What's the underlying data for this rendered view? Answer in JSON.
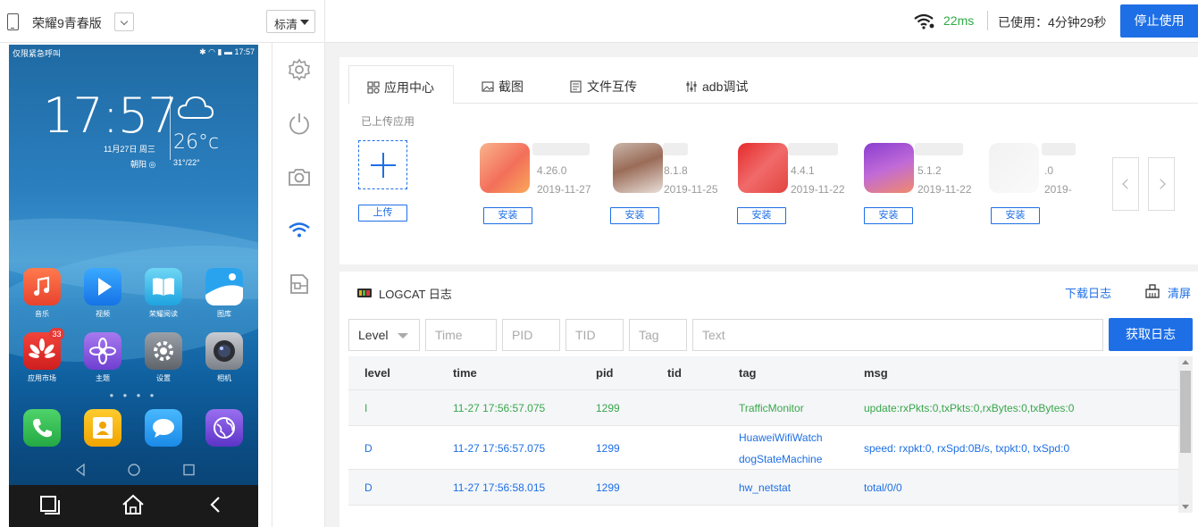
{
  "topbar": {
    "device_name": "荣耀9青春版",
    "quality": "标清",
    "ping": "22ms",
    "used_time": "已使用：4分钟29秒",
    "stop_button": "停止使用"
  },
  "phone": {
    "status_left": "仅限紧急呼叫",
    "status_right": "17:57",
    "clock": "17:57",
    "date": "11月27日  周三",
    "location": "朝阳",
    "temperature": "26°c",
    "temp_range": "31°/22°",
    "apps_row1": [
      {
        "label": "音乐",
        "icon": "music-icon",
        "color": "#f0543a"
      },
      {
        "label": "视频",
        "icon": "video-play-icon",
        "color": "#1c8cf0"
      },
      {
        "label": "荣耀阅读",
        "icon": "book-icon",
        "color": "#2fb7e6"
      },
      {
        "label": "图库",
        "icon": "gallery-icon",
        "color": "#3aa4ee"
      }
    ],
    "apps_row2": [
      {
        "label": "应用市场",
        "icon": "app-market-icon",
        "color": "#e02b2b",
        "badge": "33"
      },
      {
        "label": "主题",
        "icon": "theme-icon",
        "color": "#8b5bd9"
      },
      {
        "label": "设置",
        "icon": "settings-icon",
        "color": "#7b7f86"
      },
      {
        "label": "相机",
        "icon": "camera-icon",
        "color": "#6a6e74"
      }
    ],
    "dock": [
      {
        "icon": "phone-call-icon",
        "color": "#3bc25a"
      },
      {
        "icon": "contacts-icon",
        "color": "#f5b40c"
      },
      {
        "icon": "messages-icon",
        "color": "#2aa2f2"
      },
      {
        "icon": "browser-icon",
        "color": "#7a4fd6"
      }
    ]
  },
  "tabs": [
    {
      "label": "应用中心",
      "icon": "grid-icon"
    },
    {
      "label": "截图",
      "icon": "image-icon"
    },
    {
      "label": "文件互传",
      "icon": "file-icon"
    },
    {
      "label": "adb调试",
      "icon": "sliders-icon"
    }
  ],
  "app_center": {
    "section_label": "已上传应用",
    "upload_label": "上传",
    "install_label": "安装",
    "apps": [
      {
        "version": "4.26.0",
        "date": "2019-11-27",
        "colors": [
          "#f78f6a",
          "#f5c9a6"
        ]
      },
      {
        "version": "8.1.8",
        "date": "2019-11-25",
        "colors": [
          "#b08e7e",
          "#e7dcd6"
        ]
      },
      {
        "version": "4.4.1",
        "date": "2019-11-22",
        "colors": [
          "#e23a3a",
          "#ef6e6e"
        ]
      },
      {
        "version": "5.1.2",
        "date": "2019-11-22",
        "colors": [
          "#9a3ad0",
          "#e08ad6"
        ]
      },
      {
        "version": "0",
        "date": "2019-",
        "colors": [
          "#eeeeee",
          "#f6f6f6"
        ]
      }
    ]
  },
  "logcat": {
    "title": "LOGCAT 日志",
    "download": "下载日志",
    "clear": "清屏",
    "filters": {
      "level": "Level",
      "time": "Time",
      "pid": "PID",
      "tid": "TID",
      "tag": "Tag",
      "text": "Text"
    },
    "fetch_button": "获取日志",
    "columns": [
      "level",
      "time",
      "pid",
      "tid",
      "tag",
      "msg"
    ],
    "rows": [
      {
        "level": "I",
        "time": "11-27 17:56:57.075",
        "pid": "1299",
        "tid": "",
        "tag": "TrafficMonitor",
        "tag2": "",
        "msg": "update:rxPkts:0,txPkts:0,rxBytes:0,txBytes:0"
      },
      {
        "level": "D",
        "time": "11-27 17:56:57.075",
        "pid": "1299",
        "tid": "",
        "tag": "HuaweiWifiWatch",
        "tag2": "dogStateMachine",
        "msg": "speed: rxpkt:0, rxSpd:0B/s, txpkt:0, txSpd:0"
      },
      {
        "level": "D",
        "time": "11-27 17:56:58.015",
        "pid": "1299",
        "tid": "",
        "tag": "hw_netstat",
        "tag2": "",
        "msg": "total/0/0"
      }
    ]
  }
}
